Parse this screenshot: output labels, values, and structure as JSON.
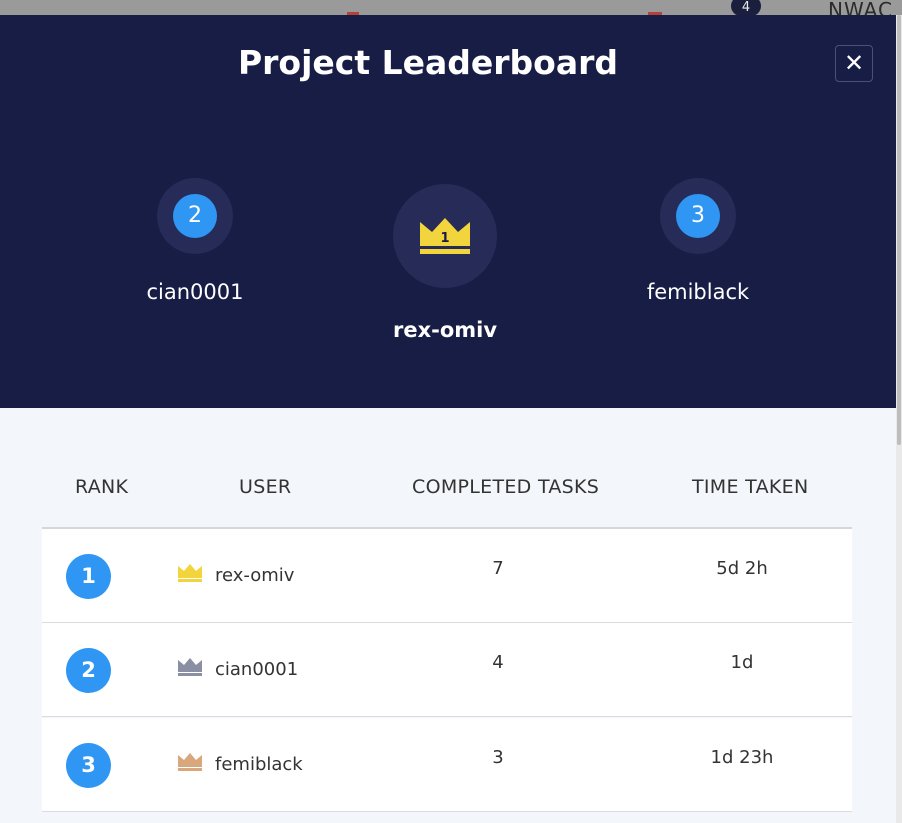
{
  "background": {
    "badge_count": "4",
    "header_text": "NWAC"
  },
  "modal": {
    "title": "Project Leaderboard",
    "close_icon": "close-icon"
  },
  "podium": {
    "first": {
      "name": "rex-omiv",
      "crown_number": "1",
      "icon": "crown-icon"
    },
    "second": {
      "rank": "2",
      "name": "cian0001"
    },
    "third": {
      "rank": "3",
      "name": "femiblack"
    }
  },
  "table": {
    "headers": {
      "rank": "RANK",
      "user": "USER",
      "tasks": "COMPLETED TASKS",
      "time": "TIME TAKEN"
    },
    "rows": [
      {
        "rank": "1",
        "user": "rex-omiv",
        "tasks": "7",
        "time": "5d 2h",
        "crown_color": "#f2d43d"
      },
      {
        "rank": "2",
        "user": "cian0001",
        "tasks": "4",
        "time": "1d",
        "crown_color": "#8a8fa3"
      },
      {
        "rank": "3",
        "user": "femiblack",
        "tasks": "3",
        "time": "1d 23h",
        "crown_color": "#d9a77c"
      }
    ]
  },
  "colors": {
    "hero_bg": "#181d45",
    "accent_blue": "#2f97f3",
    "gold": "#f2d43d",
    "silver": "#8a8fa3",
    "bronze": "#d9a77c"
  }
}
